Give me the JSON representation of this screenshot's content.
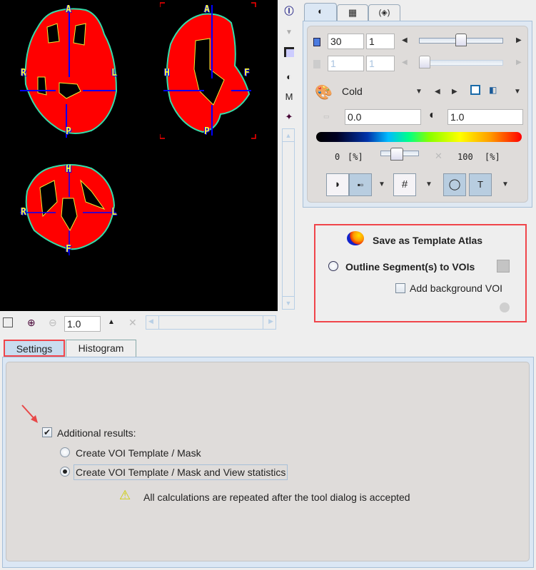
{
  "viewer": {
    "axial_labels": {
      "top": "A",
      "bottom": "P",
      "left": "R",
      "right": "L"
    },
    "sagittal_labels": {
      "top": "A",
      "bottom": "P",
      "left": "H",
      "right": "F"
    },
    "coronal_labels": {
      "top": "H",
      "bottom": "F",
      "left": "R",
      "right": "L"
    }
  },
  "viewer_toolbar": {
    "zoom_value": "1.0",
    "icons": [
      "select-checkbox",
      "zoom-in-icon",
      "zoom-out-icon",
      "eject-icon",
      "close-icon"
    ]
  },
  "side_tools": [
    "info-icon",
    "chevron-down-icon",
    "window-icon",
    "contrast-icon",
    "mip-icon",
    "crosshair-icon"
  ],
  "right_tabs": [
    {
      "name": "tab-color",
      "icon": "◐"
    },
    {
      "name": "tab-layout",
      "icon": "▦"
    },
    {
      "name": "tab-fusion",
      "icon": "(◈)"
    }
  ],
  "controls": {
    "slice_value": "30",
    "slice_step": "1",
    "frame_value": "1",
    "frame_step": "1",
    "slice_slider_fraction": 0.5,
    "frame_slider_fraction": 0.0,
    "colormap": "Cold",
    "min_value": "0.0",
    "max_value": "1.0",
    "range_min_label": "0",
    "range_max_label": "100",
    "unit_label": "[%]",
    "range_slider_fraction": 0.4
  },
  "atlas": {
    "save_template_label": "Save as Template Atlas",
    "outline_label": "Outline Segment(s) to VOIs",
    "add_background_label": "Add background VOI",
    "add_background_checked": false
  },
  "bottom_tabs": [
    {
      "label": "Settings",
      "active": true
    },
    {
      "label": "Histogram",
      "active": false
    }
  ],
  "settings": {
    "additional_results_label": "Additional results:",
    "additional_results_checked": true,
    "option1_label": "Create VOI Template / Mask",
    "option2_label": "Create VOI Template / Mask and View statistics",
    "selected_option": 2,
    "warning_text": "All calculations are repeated after the tool dialog is accepted"
  },
  "colors": {
    "highlight_red": "#f0444a",
    "brain_red": "#ff0000",
    "crosshair_blue": "#0000ff",
    "label_yellow": "#ffff33"
  }
}
